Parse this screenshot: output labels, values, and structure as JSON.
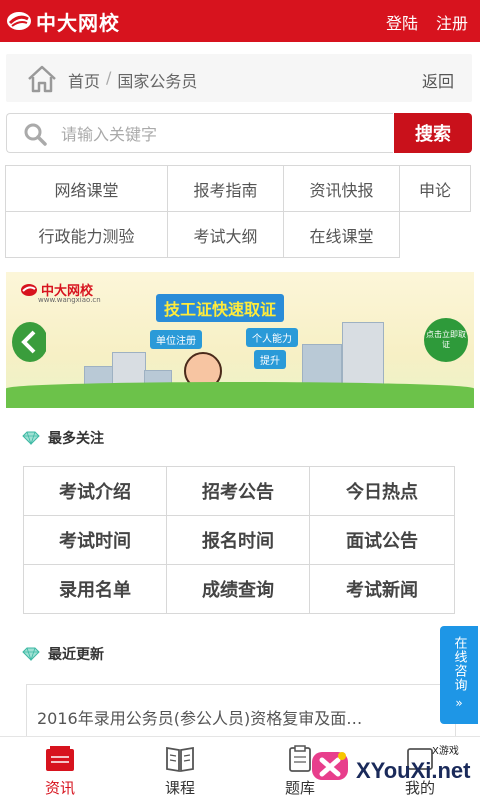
{
  "header": {
    "logo_text": "中大网校",
    "login": "登陆",
    "register": "注册",
    "brand_color": "#d7131e"
  },
  "breadcrumb": {
    "home": "首页",
    "separator": "/",
    "current": "国家公务员",
    "back": "返回"
  },
  "search": {
    "placeholder": "请输入关键字",
    "button": "搜索"
  },
  "categories": [
    [
      "网络课堂",
      "报考指南",
      "资讯快报",
      "申论"
    ],
    [
      "行政能力测验",
      "考试大纲",
      "在线课堂"
    ]
  ],
  "banner": {
    "logo_text": "中大网校",
    "logo_url": "www.wangxiao.cn",
    "title": "技工证快速取证",
    "tag1": "单位注册",
    "tag2": "个人能力",
    "tag3": "提升",
    "right_button": "点击立即取证"
  },
  "section_most_followed": {
    "title": "最多关注",
    "items": [
      [
        "考试介绍",
        "招考公告",
        "今日热点"
      ],
      [
        "考试时间",
        "报名时间",
        "面试公告"
      ],
      [
        "录用名单",
        "成绩查询",
        "考试新闻"
      ]
    ]
  },
  "section_recent": {
    "title": "最近更新",
    "items": [
      "2016年录用公务员(参公人员)资格复审及面…"
    ]
  },
  "float_button": {
    "label": "在线咨询",
    "arrow": "»"
  },
  "tabs": [
    {
      "label": "资讯",
      "icon": "news-icon",
      "active": true
    },
    {
      "label": "课程",
      "icon": "book-icon",
      "active": false
    },
    {
      "label": "题库",
      "icon": "quiz-icon",
      "active": false
    },
    {
      "label": "我的",
      "icon": "user-icon",
      "active": false
    }
  ],
  "watermark": {
    "text": "XYouXi.net",
    "small": "X游戏"
  }
}
